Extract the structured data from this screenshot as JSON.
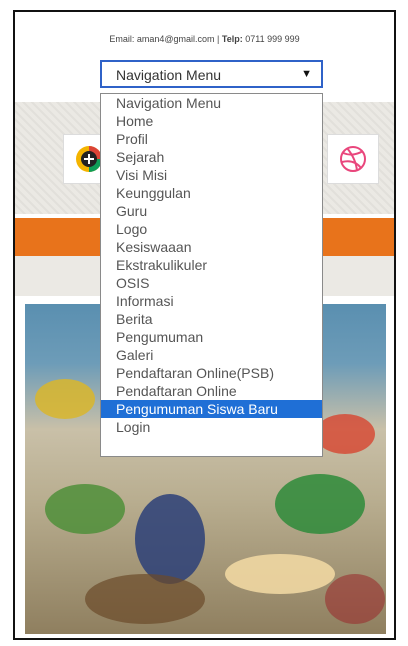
{
  "contact": {
    "email_label": "Email:",
    "email": "aman4@gmail.com",
    "separator": " | ",
    "phone_label": "Telp:",
    "phone": "0711 999 999"
  },
  "nav_select": {
    "selected": "Navigation Menu"
  },
  "dropdown": {
    "options": [
      "Navigation Menu",
      "Home",
      "Profil",
      "Sejarah",
      "Visi Misi",
      "Keunggulan",
      "Guru",
      "Logo",
      "Kesiswaaan",
      "Ekstrakulikuler",
      "OSIS",
      "Informasi",
      "Berita",
      "Pengumuman",
      "Galeri",
      "Pendaftaran Online(PSB)",
      "Pendaftaran Online",
      "Pengumuman Siswa Baru",
      "Login"
    ],
    "highlighted": "Pengumuman Siswa Baru"
  },
  "icons": {
    "left": "google-plus-icon",
    "right": "dribbble-icon"
  },
  "colors": {
    "accent": "#e8731b",
    "highlight": "#1f6fd6",
    "select_border": "#2f62c8"
  }
}
